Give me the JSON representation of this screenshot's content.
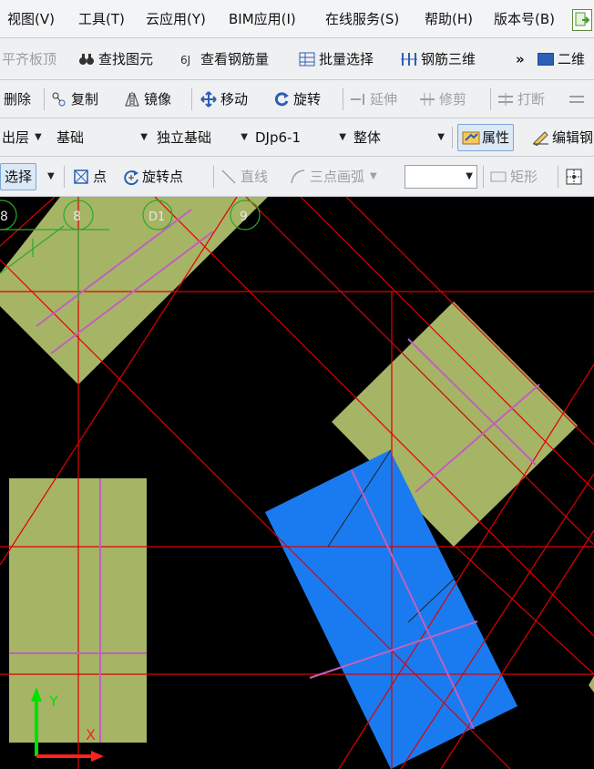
{
  "menu": {
    "items": [
      "视图(V)",
      "工具(T)",
      "云应用(Y)",
      "BIM应用(I)",
      "在线服务(S)",
      "帮助(H)",
      "版本号(B)"
    ]
  },
  "toolbar1": {
    "items": [
      "平齐板顶",
      "查找图元",
      "查看钢筋量",
      "批量选择",
      "钢筋三维"
    ],
    "overflow": "»",
    "view_label": "二维"
  },
  "toolbar2": {
    "items": [
      "删除",
      "复制",
      "镜像",
      "移动",
      "旋转",
      "延伸",
      "修剪",
      "打断"
    ]
  },
  "toolbar3": {
    "floor": "出层",
    "category": "基础",
    "component_type": "独立基础",
    "component_name": "DJp6-1",
    "scope": "整体",
    "properties_label": "属性",
    "edit_label": "编辑钢"
  },
  "toolbar4": {
    "select_label": "选择",
    "point_label": "点",
    "rotate_point_label": "旋转点",
    "line_label": "直线",
    "arc_label": "三点画弧",
    "rect_label": "矩形"
  },
  "canvas": {
    "axis_labels": [
      "8",
      "8",
      "D1",
      "9"
    ],
    "axis_y_label": "Y",
    "axis_x_label": "X",
    "colors": {
      "background": "#000000",
      "foundation_fill": "#a5b565",
      "selected_fill": "#1a7bf0",
      "grid_line": "#e00000",
      "rebar_line": "#c060c0",
      "axis_circle": "#2aa82a"
    }
  }
}
